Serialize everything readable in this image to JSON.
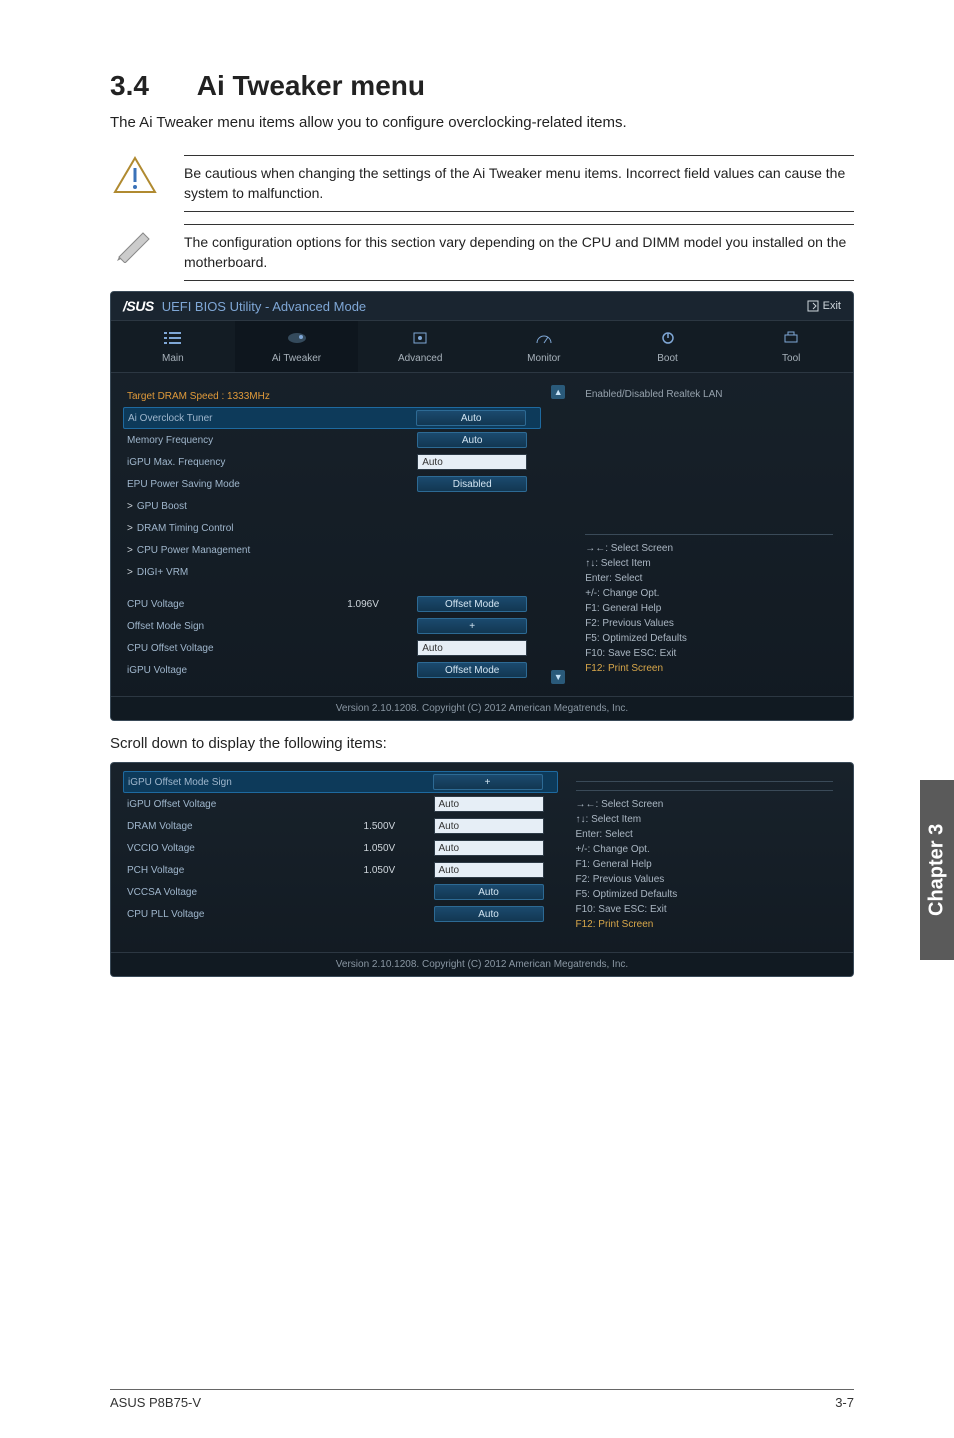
{
  "section": {
    "number": "3.4",
    "title": "Ai Tweaker menu"
  },
  "intro": "The Ai Tweaker menu items allow you to configure overclocking-related items.",
  "notes": {
    "caution": "Be cautious when changing the settings of the Ai Tweaker menu items. Incorrect field values can cause the system to malfunction.",
    "info": "The configuration options for this section vary depending on the CPU and DIMM model you installed on the motherboard."
  },
  "bios": {
    "logo": "/SUS",
    "title": "UEFI BIOS Utility - Advanced Mode",
    "exit": "Exit",
    "tabs": [
      "Main",
      "Ai Tweaker",
      "Advanced",
      "Monitor",
      "Boot",
      "Tool"
    ],
    "active_tab": 1,
    "help_top": "Enabled/Disabled Realtek LAN",
    "rows1": [
      {
        "label": "Target DRAM Speed : 1333MHz",
        "type": "text",
        "cls": "orange"
      },
      {
        "label": "Ai Overclock Tuner",
        "type": "dropdown",
        "value": "Auto",
        "selected": true
      },
      {
        "label": "Memory Frequency",
        "type": "dropdown",
        "value": "Auto"
      },
      {
        "label": "iGPU Max. Frequency",
        "type": "input",
        "value": "Auto"
      },
      {
        "label": "EPU Power Saving Mode",
        "type": "dropdown",
        "value": "Disabled"
      },
      {
        "label": "GPU Boost",
        "type": "expand"
      },
      {
        "label": "DRAM Timing Control",
        "type": "expand"
      },
      {
        "label": "CPU Power Management",
        "type": "expand"
      },
      {
        "label": "DIGI+ VRM",
        "type": "expand"
      },
      {
        "label": "",
        "type": "spacer"
      },
      {
        "label": "CPU Voltage",
        "reading": "1.096V",
        "type": "dropdown",
        "value": "Offset Mode"
      },
      {
        "label": "Offset Mode Sign",
        "type": "dropdown",
        "value": "+"
      },
      {
        "label": "CPU Offset Voltage",
        "type": "input",
        "value": "Auto"
      },
      {
        "label": "iGPU Voltage",
        "type": "dropdown",
        "value": "Offset Mode"
      }
    ],
    "help_keys": [
      "→←: Select Screen",
      "↑↓: Select Item",
      "Enter: Select",
      "+/-: Change Opt.",
      "F1: General Help",
      "F2: Previous Values",
      "F5: Optimized Defaults",
      "F10: Save   ESC: Exit",
      "F12: Print Screen"
    ],
    "footer": "Version 2.10.1208.  Copyright (C) 2012 American Megatrends, Inc."
  },
  "caption_scroll": "Scroll down to display the following items:",
  "bios2": {
    "rows": [
      {
        "label": "iGPU Offset Mode Sign",
        "type": "dropdown",
        "value": "+",
        "selected": true
      },
      {
        "label": "iGPU Offset Voltage",
        "type": "input",
        "value": "Auto"
      },
      {
        "label": "DRAM Voltage",
        "reading": "1.500V",
        "type": "input",
        "value": "Auto"
      },
      {
        "label": "VCCIO Voltage",
        "reading": "1.050V",
        "type": "input",
        "value": "Auto"
      },
      {
        "label": "PCH Voltage",
        "reading": "1.050V",
        "type": "input",
        "value": "Auto"
      },
      {
        "label": "VCCSA Voltage",
        "type": "dropdown",
        "value": "Auto"
      },
      {
        "label": "CPU PLL Voltage",
        "type": "dropdown",
        "value": "Auto"
      }
    ]
  },
  "chapter_tab": "Chapter 3",
  "footer": {
    "left": "ASUS P8B75-V",
    "right": "3-7"
  }
}
